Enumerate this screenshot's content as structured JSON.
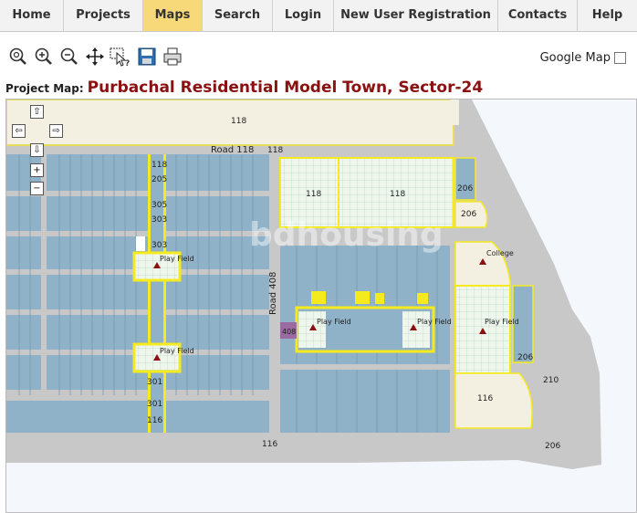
{
  "nav": {
    "items": [
      {
        "label": "Home"
      },
      {
        "label": "Projects"
      },
      {
        "label": "Maps"
      },
      {
        "label": "Search"
      },
      {
        "label": "Login"
      },
      {
        "label": "New User Registration"
      },
      {
        "label": "Contacts"
      },
      {
        "label": "Help"
      }
    ],
    "active": "Maps"
  },
  "toolbar": {
    "icons": [
      "zoom-fit-icon",
      "zoom-in-icon",
      "zoom-out-icon",
      "pan-icon",
      "identify-icon",
      "save-icon",
      "print-icon"
    ]
  },
  "google_map": {
    "label": "Google Map",
    "checked": false
  },
  "project": {
    "label": "Project Map:",
    "title": "Purbachal Residential Model Town, Sector-24"
  },
  "map": {
    "roads": {
      "road118": "Road 118",
      "road408": "Road 408"
    },
    "labels": {
      "top_118": "118",
      "road118_num": "118",
      "block_118_left": "118",
      "block_118_right": "118",
      "l_118": "118",
      "l_205a": "205",
      "l_305a": "305",
      "l_303a": "303",
      "l_303b": "303",
      "l_206a": "206",
      "l_206b": "206",
      "l_206c": "206",
      "l_210": "210",
      "l_116a": "116",
      "l_116b": "116",
      "l_116c": "116",
      "l_206d": "206",
      "l_301a": "301",
      "l_301b": "301",
      "l_408": "408",
      "college": "College",
      "play1": "Play Field",
      "play2": "Play Field",
      "play3": "Play Field",
      "play4": "Play Field",
      "play5": "Play Field"
    },
    "watermark": "bdhousing",
    "colors": {
      "plot": "#8fb2c8",
      "park": "#eef6ee",
      "road": "#c8c8c8",
      "yellow": "#f5ea1e",
      "beige": "#f3efe1",
      "water": "#f4f8fc",
      "purple": "#9c6aa2"
    }
  }
}
